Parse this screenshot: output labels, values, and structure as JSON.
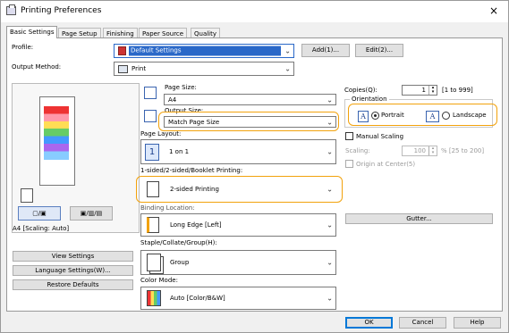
{
  "window": {
    "title": "Printing Preferences",
    "close_glyph": "×"
  },
  "tabs": [
    {
      "label": "Basic Settings",
      "active": true
    },
    {
      "label": "Page Setup",
      "active": false
    },
    {
      "label": "Finishing",
      "active": false
    },
    {
      "label": "Paper Source",
      "active": false
    },
    {
      "label": "Quality",
      "active": false
    }
  ],
  "profile": {
    "label": "Profile:",
    "value": "Default Settings",
    "add_label": "Add(1)...",
    "edit_label": "Edit(2)..."
  },
  "output_method": {
    "label": "Output Method:",
    "value": "Print"
  },
  "preview": {
    "caption": "A4 [Scaling: Auto]",
    "btn1": "▢/▣",
    "btn2": "▣/▥/▤"
  },
  "page_size": {
    "label": "Page Size:",
    "value": "A4"
  },
  "output_size": {
    "label": "Output Size:",
    "value": "Match Page Size"
  },
  "page_layout": {
    "label": "Page Layout:",
    "value": "1 on 1",
    "icon_text": "1"
  },
  "sided": {
    "label": "1-sided/2-sided/Booklet Printing:",
    "value": "2-sided Printing"
  },
  "binding": {
    "label": "Binding Location:",
    "value": "Long Edge [Left]"
  },
  "staple": {
    "label": "Staple/Collate/Group(H):",
    "value": "Group"
  },
  "color_mode": {
    "label": "Color Mode:",
    "value": "Auto [Color/B&W]"
  },
  "copies": {
    "label": "Copies(Q):",
    "value": "1",
    "range": "[1 to 999]"
  },
  "orientation": {
    "label": "Orientation",
    "portrait": "Portrait",
    "landscape": "Landscape",
    "selected": "portrait"
  },
  "manual_scaling": {
    "label": "Manual Scaling",
    "checked": false
  },
  "scaling": {
    "label": "Scaling:",
    "value": "100",
    "range": "% [25 to 200]"
  },
  "origin": {
    "label": "Origin at Center(5)"
  },
  "gutter": {
    "label": "Gutter..."
  },
  "left_buttons": {
    "view_settings": "View Settings",
    "language_settings": "Language Settings(W)...",
    "restore_defaults": "Restore Defaults"
  },
  "footer": {
    "ok": "OK",
    "cancel": "Cancel",
    "help": "Help"
  },
  "colors": {
    "highlight": "#f2a20c",
    "selection": "#2a68c8",
    "default_button": "#0078d7"
  }
}
